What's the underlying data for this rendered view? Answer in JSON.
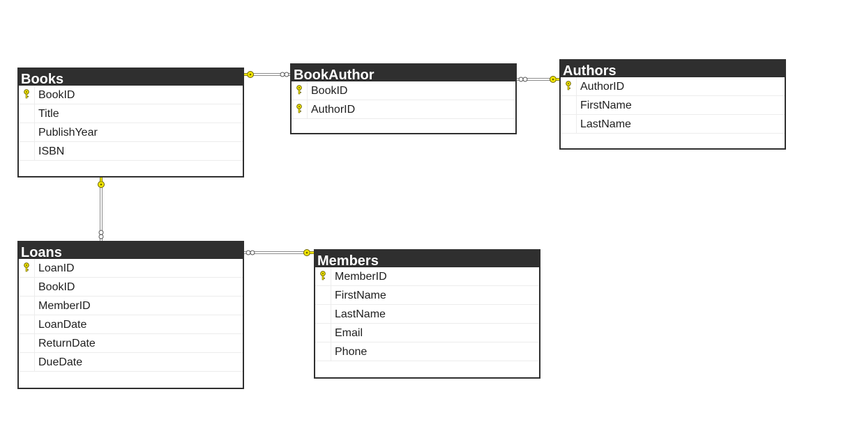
{
  "diagram": {
    "tables": [
      {
        "id": "books",
        "title": "Books",
        "columns": [
          {
            "name": "BookID",
            "pk": true
          },
          {
            "name": "Title",
            "pk": false
          },
          {
            "name": "PublishYear",
            "pk": false
          },
          {
            "name": "ISBN",
            "pk": false
          }
        ]
      },
      {
        "id": "bookauthor",
        "title": "BookAuthor",
        "columns": [
          {
            "name": "BookID",
            "pk": true
          },
          {
            "name": "AuthorID",
            "pk": true
          }
        ]
      },
      {
        "id": "authors",
        "title": "Authors",
        "columns": [
          {
            "name": "AuthorID",
            "pk": true
          },
          {
            "name": "FirstName",
            "pk": false
          },
          {
            "name": "LastName",
            "pk": false
          }
        ]
      },
      {
        "id": "loans",
        "title": "Loans",
        "columns": [
          {
            "name": "LoanID",
            "pk": true
          },
          {
            "name": "BookID",
            "pk": false
          },
          {
            "name": "MemberID",
            "pk": false
          },
          {
            "name": "LoanDate",
            "pk": false
          },
          {
            "name": "ReturnDate",
            "pk": false
          },
          {
            "name": "DueDate",
            "pk": false
          }
        ]
      },
      {
        "id": "members",
        "title": "Members",
        "columns": [
          {
            "name": "MemberID",
            "pk": true
          },
          {
            "name": "FirstName",
            "pk": false
          },
          {
            "name": "LastName",
            "pk": false
          },
          {
            "name": "Email",
            "pk": false
          },
          {
            "name": "Phone",
            "pk": false
          }
        ]
      }
    ],
    "relationships": [
      {
        "from": "books",
        "to": "bookauthor",
        "one_end": "books",
        "many_end": "bookauthor"
      },
      {
        "from": "authors",
        "to": "bookauthor",
        "one_end": "authors",
        "many_end": "bookauthor"
      },
      {
        "from": "books",
        "to": "loans",
        "one_end": "books",
        "many_end": "loans"
      },
      {
        "from": "members",
        "to": "loans",
        "one_end": "members",
        "many_end": "loans"
      }
    ],
    "colors": {
      "header": "#2f2f2f",
      "border": "#2f2f2f",
      "key": "#f2e600",
      "key_outline": "#6b6300",
      "line": "#8c8c8c"
    }
  }
}
